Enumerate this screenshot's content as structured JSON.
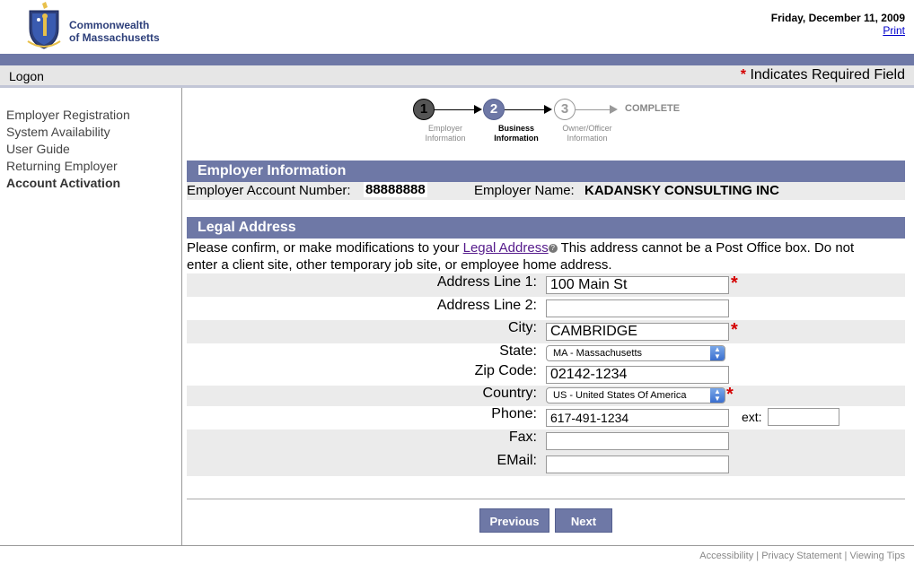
{
  "header": {
    "org_line1": "Commonwealth",
    "org_line2": "of Massachusetts",
    "date": "Friday, December 11, 2009",
    "print_label": "Print"
  },
  "topbar": {
    "logon_label": "Logon",
    "required_star": "*",
    "required_note": " Indicates Required Field"
  },
  "sidebar": {
    "items": [
      {
        "label": "Employer Registration"
      },
      {
        "label": "System Availability"
      },
      {
        "label": "User Guide"
      },
      {
        "label": "Returning Employer"
      },
      {
        "label": "Account Activation"
      }
    ]
  },
  "steps": [
    {
      "num": "1",
      "line1": "Employer",
      "line2": "Information"
    },
    {
      "num": "2",
      "line1": "Business",
      "line2": "Information"
    },
    {
      "num": "3",
      "line1": "Owner/Officer",
      "line2": "Information"
    }
  ],
  "complete_label": "COMPLETE",
  "employer_info": {
    "title": "Employer Information",
    "account_label": "Employer Account Number:",
    "account_value": "88888888",
    "name_label": "Employer Name:",
    "name_value": "KADANSKY CONSULTING INC"
  },
  "legal_address": {
    "title": "Legal Address",
    "intro_before": "Please confirm, or make modifications to your ",
    "intro_link": "Legal Address",
    "help_glyph": "?",
    "intro_after": " This address cannot be a Post Office box. Do not",
    "intro_line2": "enter a client site, other temporary job site, or employee home address."
  },
  "form": {
    "address1_label": "Address Line 1:",
    "address1_value": "100 Main St",
    "address2_label": "Address Line 2:",
    "address2_value": "",
    "city_label": "City:",
    "city_value": "CAMBRIDGE",
    "state_label": "State:",
    "state_value": "MA - Massachusetts",
    "zip_label": "Zip Code:",
    "zip_value": "02142-1234",
    "country_label": "Country:",
    "country_value": "US - United States Of America",
    "phone_label": "Phone:",
    "phone_value": "617-491-1234",
    "ext_label": "ext:",
    "ext_value": "",
    "fax_label": "Fax:",
    "fax_value": "",
    "email_label": "EMail:",
    "email_value": "",
    "star": "*"
  },
  "buttons": {
    "previous": "Previous",
    "next": "Next"
  },
  "footer": {
    "accessibility": "Accessibility",
    "privacy": "Privacy Statement",
    "viewing_tips": "Viewing Tips",
    "separator": " | "
  },
  "colors": {
    "navy": "#6e78a6",
    "required_red": "#d40000",
    "link_purple": "#551a8b"
  }
}
